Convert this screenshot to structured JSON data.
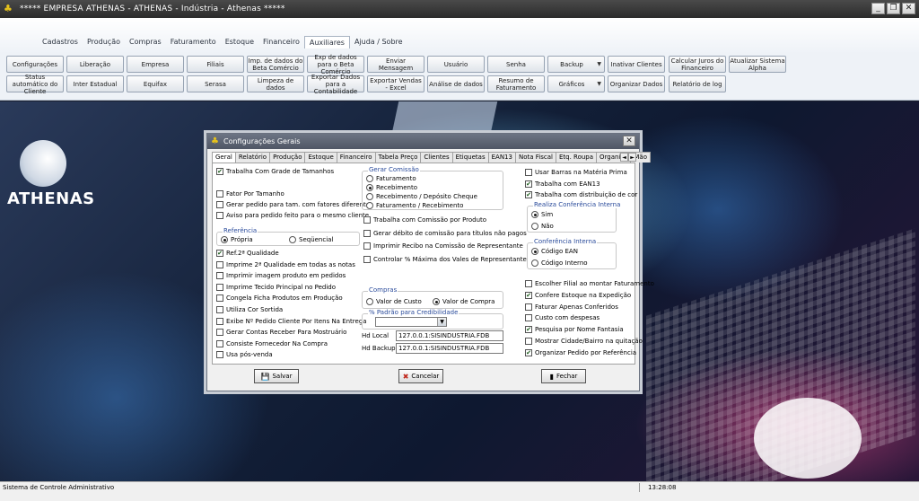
{
  "window": {
    "title": "***** EMPRESA ATHENAS -   ATHENAS - Indústria - Athenas *****"
  },
  "menu": {
    "tabs": [
      "Cadastros",
      "Produção",
      "Compras",
      "Faturamento",
      "Estoque",
      "Financeiro",
      "Auxiliares",
      "Ajuda / Sobre"
    ],
    "active": "Auxiliares"
  },
  "ribbon": {
    "row1": [
      "Configurações",
      "Liberação",
      "Empresa",
      "Filiais",
      "Imp. de dados do Beta Comércio",
      "Exp de dados para o Beta Comércio",
      "Enviar Mensagem",
      "Usuário",
      "Senha",
      "Backup",
      "Inativar Clientes",
      "Calcular Juros do Financeiro",
      "Atualizar Sistema Alpha"
    ],
    "row2": [
      "Status automático do Cliente",
      "Inter Estadual",
      "Equifax",
      "Serasa",
      "Limpeza de dados",
      "Exportar Dados para a Contabilidade",
      "Exportar Vendas - Excel",
      "Análise de dados",
      "Resumo de Faturamento",
      "Gráficos",
      "Organizar Dados",
      "Relatório de log"
    ]
  },
  "desktop": {
    "logo_text": "ATHENAS"
  },
  "status": {
    "left": "Sistema de Controle Administrativo",
    "time": "13:28:08"
  },
  "dialog": {
    "title": "Configurações Gerais",
    "tabs": [
      "Geral",
      "Relatório",
      "Produção",
      "Estoque",
      "Financeiro",
      "Tabela Preço",
      "Clientes",
      "Etiquetas",
      "EAN13",
      "Nota Fiscal",
      "Etq. Roupa",
      "Organiza",
      "Mão"
    ],
    "col1": [
      {
        "label": "Trabalha Com Grade de Tamanhos",
        "checked": true
      },
      {
        "label": "Fator Por Tamanho",
        "checked": false
      },
      {
        "label": "Gerar pedido para tam. com fatores diferentes",
        "checked": false
      },
      {
        "label": "Aviso para pedido feito para o mesmo cliente",
        "checked": false
      }
    ],
    "referencia": {
      "label": "Referência",
      "options": [
        "Própria",
        "Seqüencial"
      ],
      "selected": 0
    },
    "col1b": [
      {
        "label": "Ref.2ª Qualidade",
        "checked": true
      },
      {
        "label": "Imprime 2ª Qualidade em todas as notas",
        "checked": false
      },
      {
        "label": "Imprimir imagem produto em pedidos",
        "checked": false
      },
      {
        "label": "Imprime Tecido Principal no Pedido",
        "checked": false
      },
      {
        "label": "Congela Ficha Produtos em Produção",
        "checked": false
      },
      {
        "label": "Utiliza Cor Sortida",
        "checked": false
      },
      {
        "label": "Exibe Nº Pedido Cliente Por Itens Na Entrega",
        "checked": false
      },
      {
        "label": "Gerar Contas Receber Para Mostruário",
        "checked": false
      },
      {
        "label": "Consiste Fornecedor Na Compra",
        "checked": false
      },
      {
        "label": "Usa pós-venda",
        "checked": false
      }
    ],
    "gerar_comissao": {
      "label": "Gerar Comissão",
      "options": [
        "Faturamento",
        "Recebimento",
        "Recebimento / Depósito Cheque",
        "Faturamento / Recebimento"
      ],
      "selected": 1
    },
    "col2": [
      {
        "label": "Trabalha com Comissão por Produto",
        "checked": false
      },
      {
        "label": "Gerar débito de comissão para títulos não pagos",
        "checked": false
      },
      {
        "label": "Imprimir Recibo na Comissão de Representante",
        "checked": false
      },
      {
        "label": "Controlar % Máxima dos Vales de Representante",
        "checked": false
      }
    ],
    "compras": {
      "label": "Compras",
      "options": [
        "Valor de Custo",
        "Valor de Compra"
      ],
      "selected": 1
    },
    "padrao_credibilidade": {
      "label": "% Padrão para Credibilidade",
      "value": ""
    },
    "hd_local": {
      "label": "Hd Local",
      "value": "127.0.0.1:SISINDUSTRIA.FDB"
    },
    "hd_backup": {
      "label": "Hd Backup",
      "value": "127.0.0.1:SISINDUSTRIA.FDB"
    },
    "col3": [
      {
        "label": "Usar Barras na Matéria Prima",
        "checked": false
      },
      {
        "label": "Trabalha com EAN13",
        "checked": true
      },
      {
        "label": "Trabalha com distribuição de cor",
        "checked": true
      }
    ],
    "realiza_conferencia": {
      "label": "Realiza Conferência Interna",
      "options": [
        "Sim",
        "Não"
      ],
      "selected": 0
    },
    "conferencia_interna": {
      "label": "Conferência Interna",
      "options": [
        "Código EAN",
        "Código Interno"
      ],
      "selected": 0
    },
    "col3b": [
      {
        "label": "Escolher Filial ao montar Faturamento",
        "checked": false
      },
      {
        "label": "Confere Estoque na Expedição",
        "checked": true
      },
      {
        "label": "Faturar Apenas Conferidos",
        "checked": false
      },
      {
        "label": "Custo com despesas",
        "checked": false
      },
      {
        "label": "Pesquisa por Nome Fantasia",
        "checked": true
      },
      {
        "label": "Mostrar Cidade/Bairro na quitação",
        "checked": false
      },
      {
        "label": "Organizar Pedido por Referência",
        "checked": true
      }
    ],
    "buttons": {
      "save": "Salvar",
      "cancel": "Cancelar",
      "close": "Fechar"
    }
  }
}
